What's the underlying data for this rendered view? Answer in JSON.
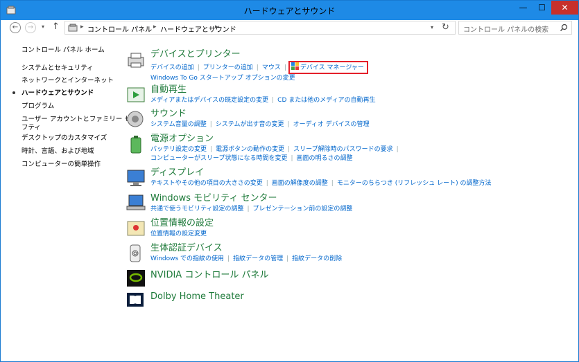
{
  "window": {
    "title": "ハードウェアとサウンド",
    "controls": {
      "minimize": "—",
      "maximize": "☐",
      "close": "✕"
    }
  },
  "nav": {
    "back": "←",
    "forward": "→",
    "dropdown": "▾",
    "up": "↑"
  },
  "address": {
    "crumbs": [
      "コントロール パネル",
      "ハードウェアとサウンド"
    ],
    "separator": "▸",
    "dropdown": "▾",
    "refresh": "↻"
  },
  "search": {
    "placeholder": "コントロール パネルの検索"
  },
  "left_nav": {
    "items": [
      "コントロール パネル ホーム",
      "システムとセキュリティ",
      "ネットワークとインターネット",
      "ハードウェアとサウンド",
      "プログラム",
      "ユーザー アカウントとファミリー セー",
      "フティ",
      "デスクトップのカスタマイズ",
      "時計、言語、および地域",
      "コンピューターの簡単操作"
    ]
  },
  "categories": [
    {
      "title": "デバイスとプリンター",
      "links": [
        "デバイスの追加",
        "プリンターの追加",
        "マウス",
        "デバイス マネージャー"
      ],
      "links2": [
        "Windows To Go スタートアップ オプションの変更"
      ]
    },
    {
      "title": "自動再生",
      "links": [
        "メディアまたはデバイスの既定設定の変更",
        "CD または他のメディアの自動再生"
      ]
    },
    {
      "title": "サウンド",
      "links": [
        "システム音量の調整",
        "システムが出す音の変更",
        "オーディオ デバイスの管理"
      ]
    },
    {
      "title": "電源オプション",
      "links": [
        "バッテリ設定の変更",
        "電源ボタンの動作の変更",
        "スリープ解除時のパスワードの要求"
      ],
      "links2": [
        "コンピューターがスリープ状態になる時間を変更",
        "画面の明るさの調整"
      ]
    },
    {
      "title": "ディスプレイ",
      "links": [
        "テキストやその他の項目の大きさの変更",
        "画面の解像度の調整",
        "モニターのちらつき (リフレッシュ レート) の調整方法"
      ]
    },
    {
      "title": "Windows モビリティ センター",
      "links": [
        "共通で使うモビリティ設定の調整",
        "プレゼンテーション前の設定の調整"
      ]
    },
    {
      "title": "位置情報の設定",
      "links": [
        "位置情報の設定変更"
      ]
    },
    {
      "title": "生体認証デバイス",
      "links": [
        "Windows での指紋の使用",
        "指紋データの管理",
        "指紋データの削除"
      ]
    },
    {
      "title": "NVIDIA コントロール パネル"
    },
    {
      "title": "Dolby Home Theater"
    }
  ],
  "colors": {
    "titlebar": "#1e8ae6",
    "close": "#c7302b",
    "link": "#0066cc",
    "heading": "#1e7a3a",
    "highlight": "#e4202a"
  }
}
